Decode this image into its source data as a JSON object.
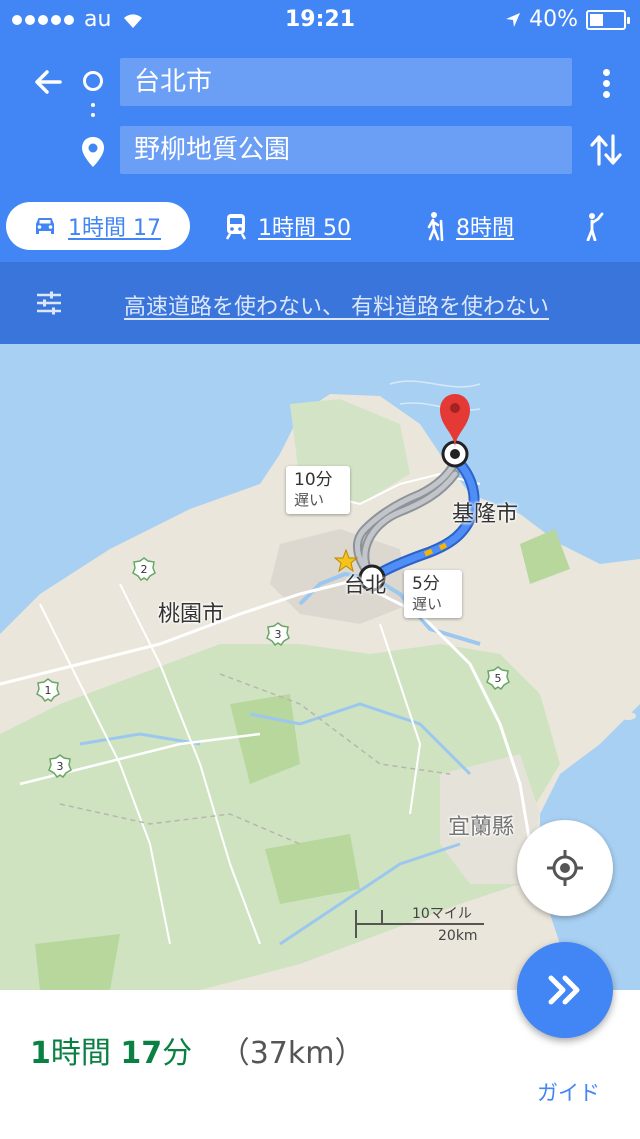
{
  "status_bar": {
    "carrier": "au",
    "time": "19:21",
    "battery": "40%",
    "battery_level": 0.4
  },
  "search": {
    "origin": "台北市",
    "destination": "野柳地質公園"
  },
  "modes": {
    "car": "1時間 17",
    "transit": "1時間 50",
    "walk": "8時間"
  },
  "options_text": "高速道路を使わない、 有料道路を使わない",
  "map": {
    "labels": {
      "keelung": "基隆市",
      "taoyuan": "桃園市",
      "yilan": "宜蘭縣",
      "taipei": "台北"
    },
    "callouts": [
      {
        "time": "10分",
        "note": "遅い"
      },
      {
        "time": "5分",
        "note": "遅い"
      }
    ],
    "route_shields": [
      "2",
      "3",
      "1",
      "3",
      "5"
    ],
    "scale": {
      "miles": "10マイル",
      "km": "20km"
    }
  },
  "summary": {
    "hours_num": "1",
    "hours_unit": "時間",
    "minutes_num": "17",
    "minutes_unit": "分",
    "distance": "（37km）"
  },
  "guide_label": "ガイド",
  "colors": {
    "primary": "#4285f4",
    "header_options": "#3a75dc",
    "summary_green": "#0b8043",
    "route_blue": "#4f8ef7",
    "route_gray": "#9aa0a6",
    "pin_red": "#e53935"
  }
}
